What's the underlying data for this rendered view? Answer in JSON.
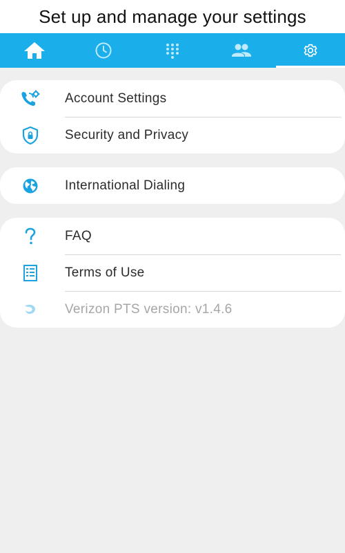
{
  "headline": "Set up and manage your settings",
  "colors": {
    "accent": "#1aaeea",
    "background": "#efefef"
  },
  "tabs": [
    {
      "icon": "home-icon",
      "active": false
    },
    {
      "icon": "clock-icon",
      "active": false
    },
    {
      "icon": "dialpad-icon",
      "active": false
    },
    {
      "icon": "contacts-icon",
      "active": false
    },
    {
      "icon": "gear-icon",
      "active": true
    }
  ],
  "settings": {
    "account_settings": "Account Settings",
    "security_privacy": "Security and Privacy",
    "international_dialing": "International Dialing",
    "faq": "FAQ",
    "terms_of_use": "Terms of Use",
    "version": "Verizon PTS version: v1.4.6"
  }
}
